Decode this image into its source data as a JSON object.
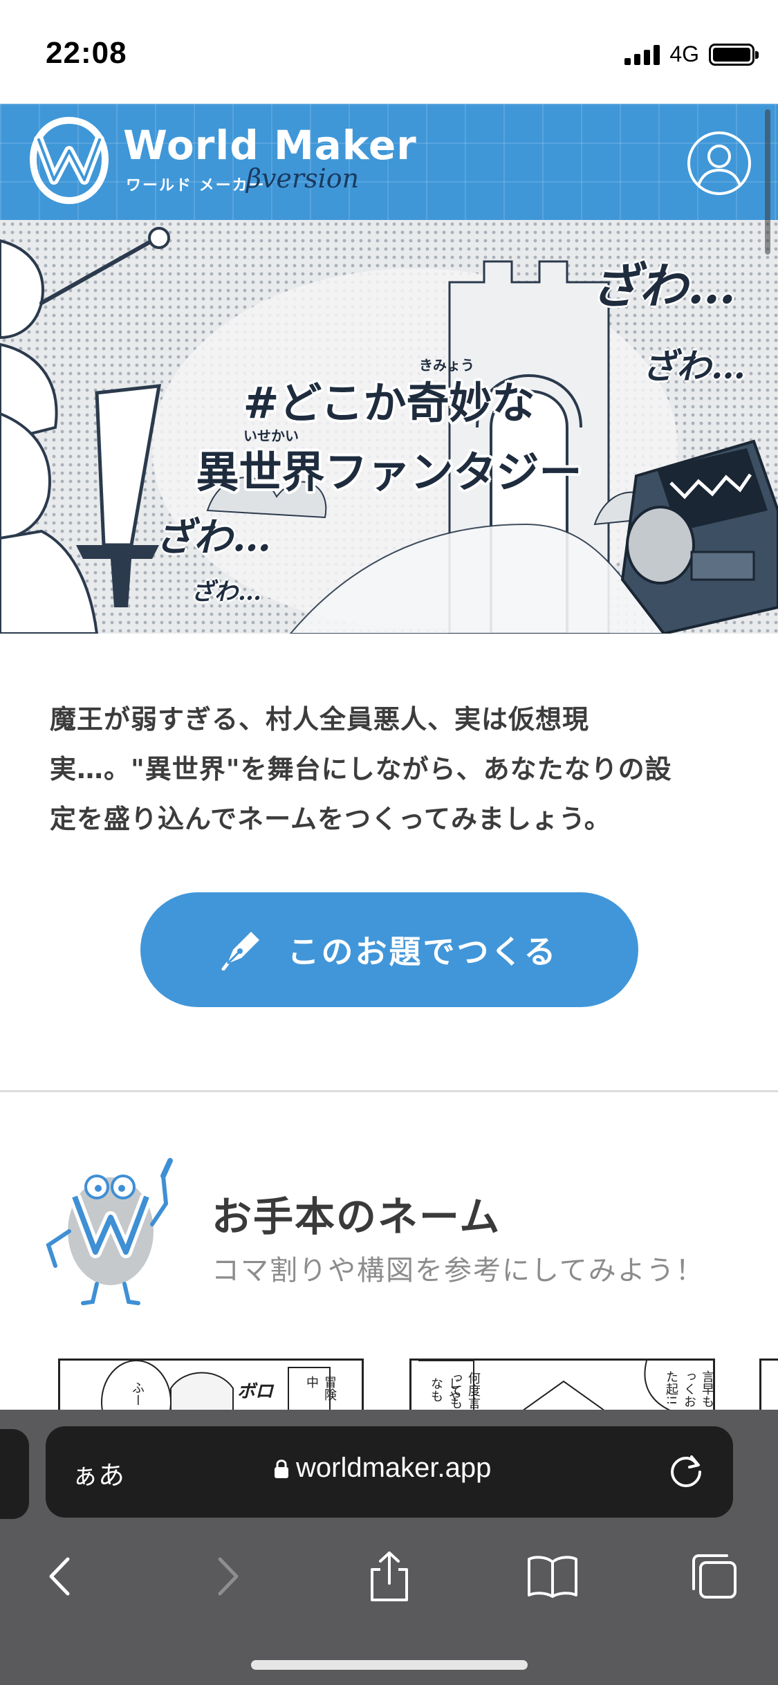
{
  "status_bar": {
    "time": "22:08",
    "network": "4G",
    "icons": [
      "signal-icon",
      "battery-icon"
    ]
  },
  "header": {
    "logo_title": "World Maker",
    "logo_subtitle": "ワールド メーカー",
    "beta_label": "βversion",
    "account_icon": "user-icon",
    "colors": {
      "brand_blue": "#3f97d8"
    }
  },
  "hero": {
    "title_line1": "#どこか奇妙な",
    "title_line2": "異世界ファンタジー",
    "ruby_1": "きみょう",
    "ruby_2": "いせかい",
    "sfx_large_1": "ざわ…",
    "sfx_small_1": "ざわ…",
    "sfx_large_2": "ざわ…",
    "sfx_small_2": "ざわ…"
  },
  "description": {
    "line1": "魔王が弱すぎる、村人全員悪人、実は仮想現",
    "line2": "実…。\"異世界\"を舞台にしながら、あなたなりの設",
    "line3": "定を盛り込んでネームをつくってみましょう。"
  },
  "cta": {
    "label": "このお題でつくる",
    "icon": "pen-nib-icon",
    "color": "#4196d9"
  },
  "samples": {
    "title": "お手本のネーム",
    "subtitle": "コマ割りや構図を参考にしてみよう！",
    "thumb1_texts": [
      "ふー",
      "ボロ",
      "冒険中"
    ],
    "thumb2_texts": [
      "何度言っても",
      "じやなも",
      "言早もっくおた起!!"
    ]
  },
  "browser": {
    "aa_label": "ぁあ",
    "url": "worldmaker.app",
    "icons": [
      "lock-icon",
      "reload-icon",
      "back-icon",
      "forward-icon",
      "share-icon",
      "bookmarks-icon",
      "tabs-icon"
    ]
  }
}
